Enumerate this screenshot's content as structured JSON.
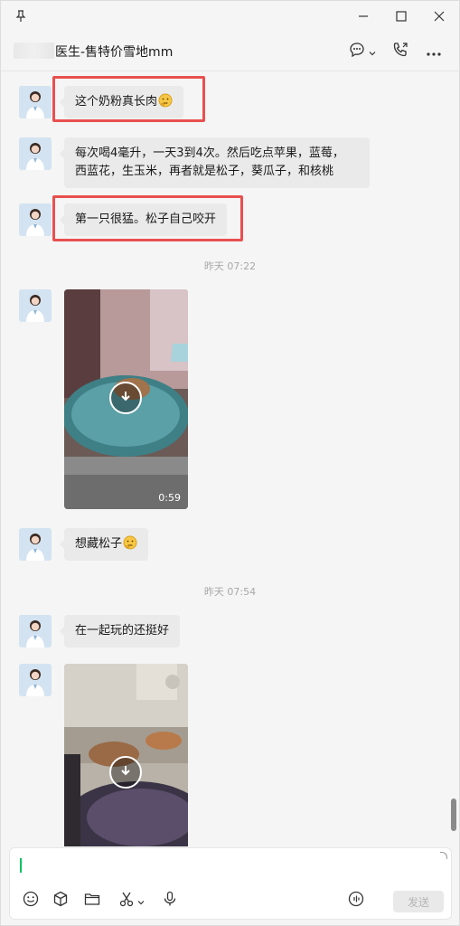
{
  "window": {
    "title": "医生-售特价雪地mm"
  },
  "messages": [
    {
      "type": "text",
      "text": "这个奶粉真长肉",
      "emoji": "thinking-face",
      "highlighted": true
    },
    {
      "type": "text",
      "lines": [
        "每次喝4毫升，一天3到4次。然后吃点苹果，蓝莓，",
        "西蓝花，生玉米，再者就是松子，葵瓜子，和核桃"
      ],
      "highlighted": false
    },
    {
      "type": "text",
      "text": "第一只很猛。松子自己咬开",
      "highlighted": true
    },
    {
      "type": "time",
      "text": "昨天 07:22"
    },
    {
      "type": "video",
      "duration": "0:59"
    },
    {
      "type": "text",
      "text": "想藏松子",
      "emoji": "thinking-face"
    },
    {
      "type": "time",
      "text": "昨天 07:54"
    },
    {
      "type": "text",
      "text": "在一起玩的还挺好"
    },
    {
      "type": "video",
      "duration": ""
    }
  ],
  "input": {
    "value": "",
    "send_label": "发送"
  },
  "icons": {
    "pin": "pin-icon",
    "minimize": "minimize-icon",
    "maximize": "maximize-icon",
    "close": "close-icon",
    "chat": "chat-bubble-icon",
    "call": "phone-video-icon",
    "more": "more-icon",
    "emoji": "emoji-icon",
    "sticker": "cube-icon",
    "folder": "folder-icon",
    "scissors": "scissors-icon",
    "mic": "microphone-icon",
    "voice": "voice-input-icon",
    "download": "download-icon"
  },
  "colors": {
    "highlight": "#e8504f",
    "bubble": "#eaeaea",
    "caret": "#07c160"
  }
}
